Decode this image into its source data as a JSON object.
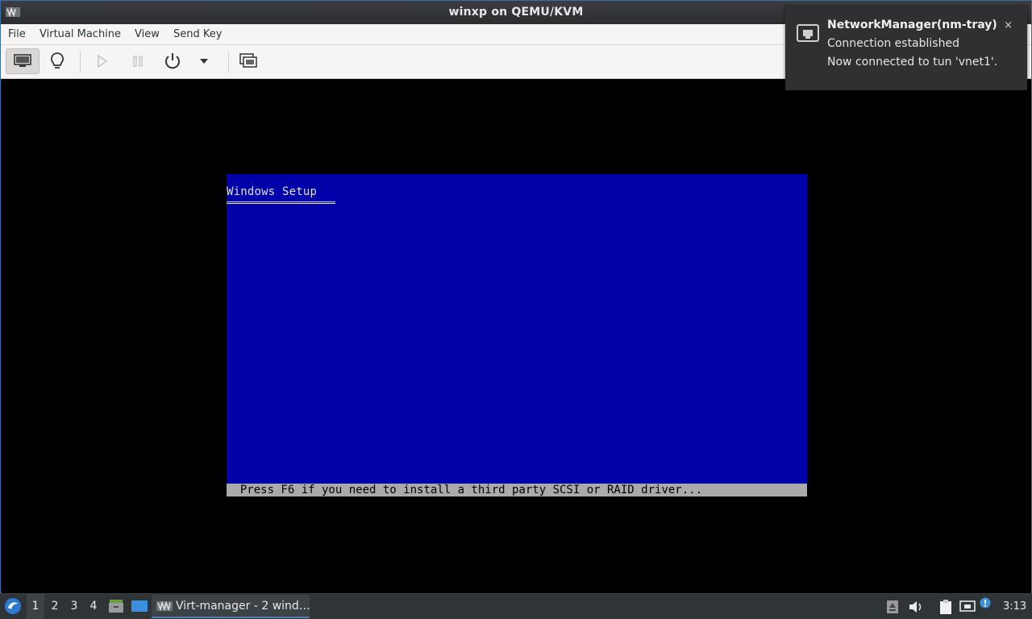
{
  "window": {
    "title": "winxp on QEMU/KVM"
  },
  "menu": {
    "items": [
      "File",
      "Virtual Machine",
      "View",
      "Send Key"
    ]
  },
  "toolbar": {
    "buttons": [
      {
        "name": "console-button",
        "icon": "monitor-icon",
        "active": true
      },
      {
        "name": "details-button",
        "icon": "lightbulb-icon"
      },
      {
        "name": "run-button",
        "icon": "play-icon",
        "disabled": true
      },
      {
        "name": "pause-button",
        "icon": "pause-icon",
        "disabled": true
      },
      {
        "name": "shutdown-button",
        "icon": "power-icon"
      },
      {
        "name": "shutdown-menu-button",
        "icon": "chevron-down-icon"
      },
      {
        "name": "fullscreen-button",
        "icon": "fullscreen-icon"
      }
    ]
  },
  "vm": {
    "setup_title": "Windows Setup",
    "status_line": "  Press F6 if you need to install a third party SCSI or RAID driver...",
    "colors": {
      "screen_bg": "#0000a8",
      "status_bg": "#aaaaaa"
    }
  },
  "notification": {
    "app": "NetworkManager(nm-tray)",
    "line1": "Connection established",
    "line2": "Now connected to tun 'vnet1'.",
    "close": "×"
  },
  "taskbar": {
    "workspaces": [
      "1",
      "2",
      "3",
      "4"
    ],
    "active_workspace": "1",
    "task_label": "Virt-manager - 2 wind…",
    "clock": "3:13"
  }
}
